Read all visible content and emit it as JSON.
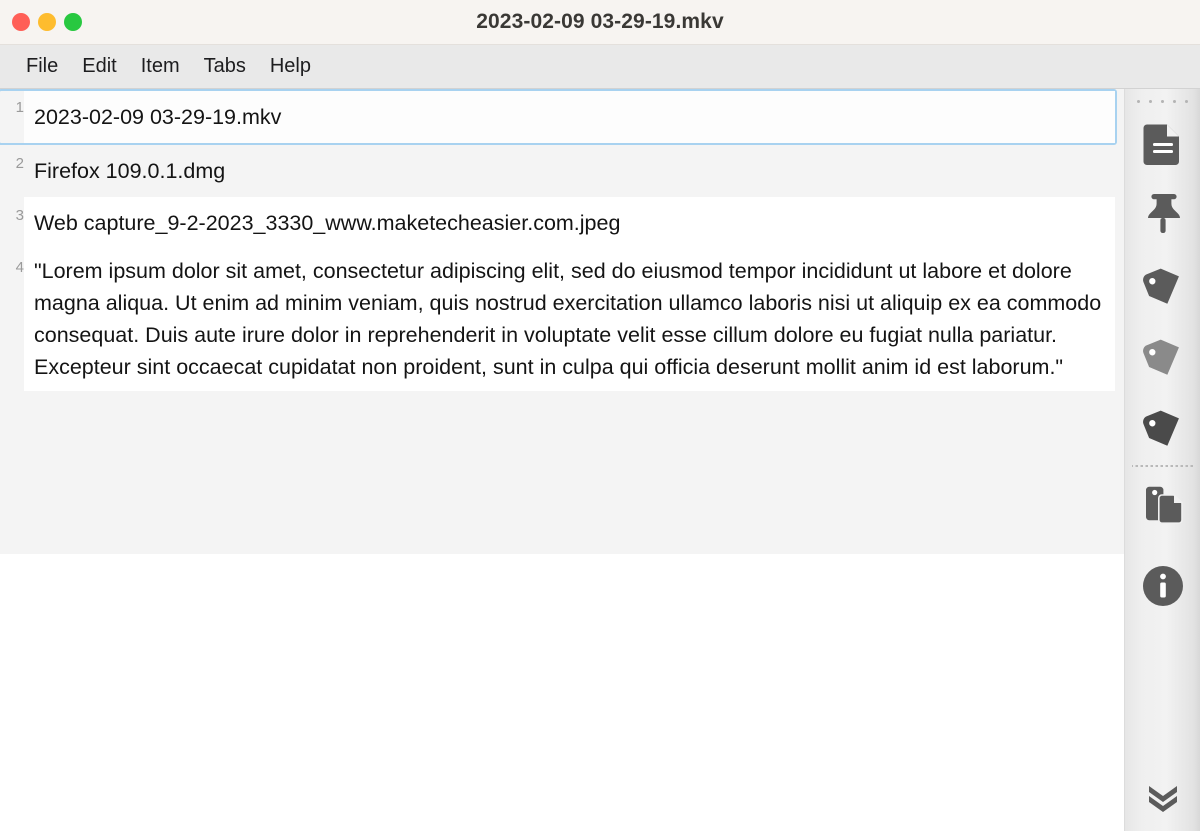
{
  "window": {
    "title": "2023-02-09 03-29-19.mkv",
    "traffic_lights": [
      {
        "name": "close",
        "label": "Close",
        "color": "#ff5f57"
      },
      {
        "name": "minimize",
        "label": "Minimize",
        "color": "#febc2e"
      },
      {
        "name": "maximize",
        "label": "Maximize",
        "color": "#28c840"
      }
    ]
  },
  "menubar": {
    "items": [
      {
        "label": "File"
      },
      {
        "label": "Edit"
      },
      {
        "label": "Item"
      },
      {
        "label": "Tabs"
      },
      {
        "label": "Help"
      }
    ]
  },
  "clipboard_list": {
    "items": [
      {
        "number": "1",
        "text": "2023-02-09 03-29-19.mkv",
        "selected": true,
        "multiline": false
      },
      {
        "number": "2",
        "text": "Firefox 109.0.1.dmg",
        "selected": false,
        "multiline": false
      },
      {
        "number": "3",
        "text": "Web capture_9-2-2023_3330_www.maketecheasier.com.jpeg",
        "selected": false,
        "multiline": false
      },
      {
        "number": "4",
        "text": "\"Lorem ipsum dolor sit amet, consectetur adipiscing elit, sed do eiusmod tempor incididunt ut labore et dolore magna aliqua. Ut enim ad minim veniam, quis nostrud exercitation ullamco laboris nisi ut aliquip ex ea commodo consequat. Duis aute irure dolor in reprehenderit in voluptate velit esse cillum dolore eu fugiat nulla pariatur. Excepteur sint occaecat cupidatat non proident, sunt in culpa qui officia deserunt mollit anim id est laborum.\"",
        "selected": false,
        "multiline": true
      }
    ]
  },
  "sidebar": {
    "drag_handle": "drag-handle-dots",
    "icons": [
      {
        "name": "document-icon",
        "title": "Document",
        "color": "#5b5b5b"
      },
      {
        "name": "pushpin-icon",
        "title": "Pin",
        "color": "#5b5b5b"
      },
      {
        "name": "tag-dark-icon",
        "title": "Tag",
        "color": "#5b5b5b"
      },
      {
        "name": "tag-light-icon",
        "title": "Tag",
        "color": "#8a8a8a"
      },
      {
        "name": "tag-darker-icon",
        "title": "Tag",
        "color": "#4a4a4a"
      },
      {
        "name": "tag-document-icon",
        "title": "Tagged document",
        "color": "#5b5b5b"
      },
      {
        "name": "info-icon",
        "title": "Info",
        "color": "#5b5b5b"
      },
      {
        "name": "chevron-double-down-icon",
        "title": "More",
        "color": "#5b5b5b"
      }
    ]
  }
}
